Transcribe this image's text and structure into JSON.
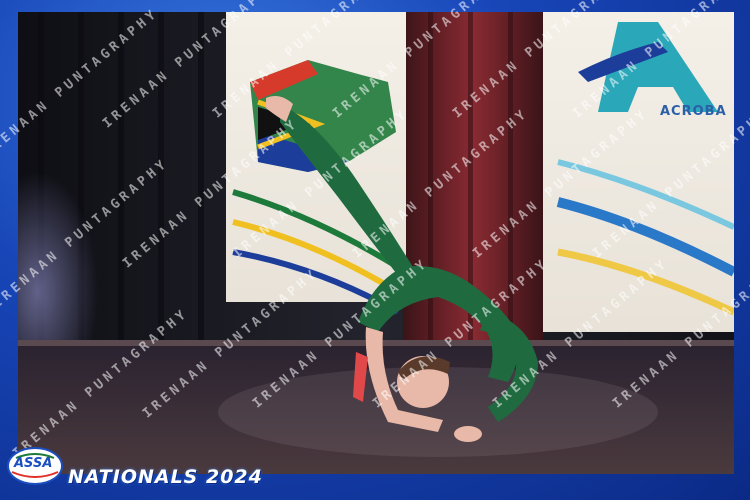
{
  "event": {
    "footer_title": "NATIONALS 2024",
    "logo_text": "ASSA",
    "banner_text": "ACROBA"
  },
  "watermark": {
    "text": "IRENAAN PUNTAGRAPHY"
  },
  "colors": {
    "frame_blue": "#1846b8",
    "leotard_green": "#1f6b3f",
    "stage_floor": "#3a2a30",
    "curtain_dark": "#1a1a22",
    "curtain_red": "#7a1f26"
  }
}
